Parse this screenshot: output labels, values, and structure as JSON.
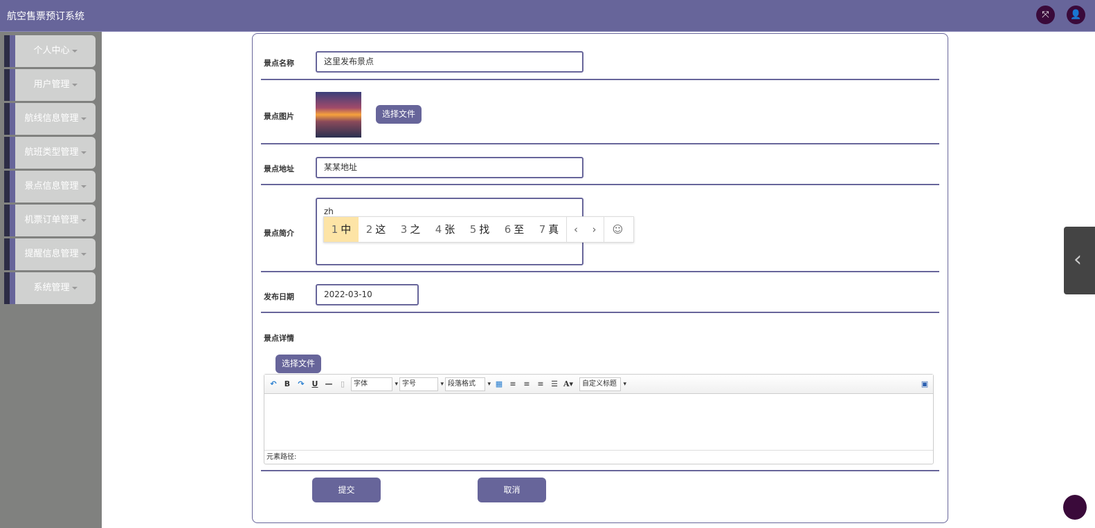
{
  "header": {
    "title": "航空售票预订系统",
    "icons": [
      "fullscreen-icon",
      "user-icon"
    ]
  },
  "sidebar": {
    "items": [
      {
        "label": "个人中心"
      },
      {
        "label": "用户管理"
      },
      {
        "label": "航线信息管理"
      },
      {
        "label": "航班类型管理"
      },
      {
        "label": "景点信息管理"
      },
      {
        "label": "机票订单管理"
      },
      {
        "label": "提醒信息管理"
      },
      {
        "label": "系统管理"
      }
    ]
  },
  "form": {
    "name": {
      "label": "景点名称",
      "value": "这里发布景点"
    },
    "image": {
      "label": "景点图片",
      "button": "选择文件"
    },
    "address": {
      "label": "景点地址",
      "value": "某某地址"
    },
    "intro": {
      "label": "景点简介",
      "value": "zh"
    },
    "date": {
      "label": "发布日期",
      "value": "2022-03-10"
    },
    "details": {
      "label": "景点详情",
      "upload_button": "选择文件"
    },
    "submit": "提交",
    "cancel": "取消"
  },
  "ime": {
    "candidates": [
      {
        "n": "1",
        "c": "中"
      },
      {
        "n": "2",
        "c": "这"
      },
      {
        "n": "3",
        "c": "之"
      },
      {
        "n": "4",
        "c": "张"
      },
      {
        "n": "5",
        "c": "找"
      },
      {
        "n": "6",
        "c": "至"
      },
      {
        "n": "7",
        "c": "真"
      }
    ],
    "prev": "‹",
    "next": "›",
    "emoji": "☺"
  },
  "editor": {
    "font": "字体",
    "size": "字号",
    "format": "段落格式",
    "custom": "自定义标题",
    "status": "元素路径:"
  },
  "colors": {
    "primary": "#67659a",
    "sidebar": "#80817f"
  }
}
